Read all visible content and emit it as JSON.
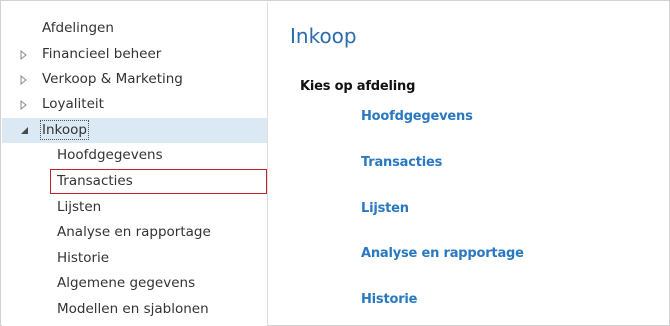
{
  "nav": {
    "items": [
      {
        "label": "Afdelingen",
        "arrow": ""
      },
      {
        "label": "Financieel beheer",
        "arrow": "collapsed-arrow-icon"
      },
      {
        "label": "Verkoop & Marketing",
        "arrow": "collapsed-arrow-icon"
      },
      {
        "label": "Loyaliteit",
        "arrow": "collapsed-arrow-icon"
      },
      {
        "label": "Inkoop",
        "arrow": "expanded-arrow-icon"
      },
      {
        "label": "Hoofdgegevens",
        "arrow": ""
      },
      {
        "label": "Transacties",
        "arrow": ""
      },
      {
        "label": "Lijsten",
        "arrow": ""
      },
      {
        "label": "Analyse en rapportage",
        "arrow": ""
      },
      {
        "label": "Historie",
        "arrow": ""
      },
      {
        "label": "Algemene gegevens",
        "arrow": ""
      },
      {
        "label": "Modellen en sjablonen",
        "arrow": ""
      }
    ]
  },
  "content": {
    "title": "Inkoop",
    "section_label": "Kies op afdeling",
    "links": [
      "Hoofdgegevens",
      "Transacties",
      "Lijsten",
      "Analyse en rapportage",
      "Historie"
    ]
  },
  "colors": {
    "title": "#2a6cac",
    "link": "#2a78c0",
    "selected_bg": "#dbe9f5",
    "highlight_box": "#c8202a"
  }
}
